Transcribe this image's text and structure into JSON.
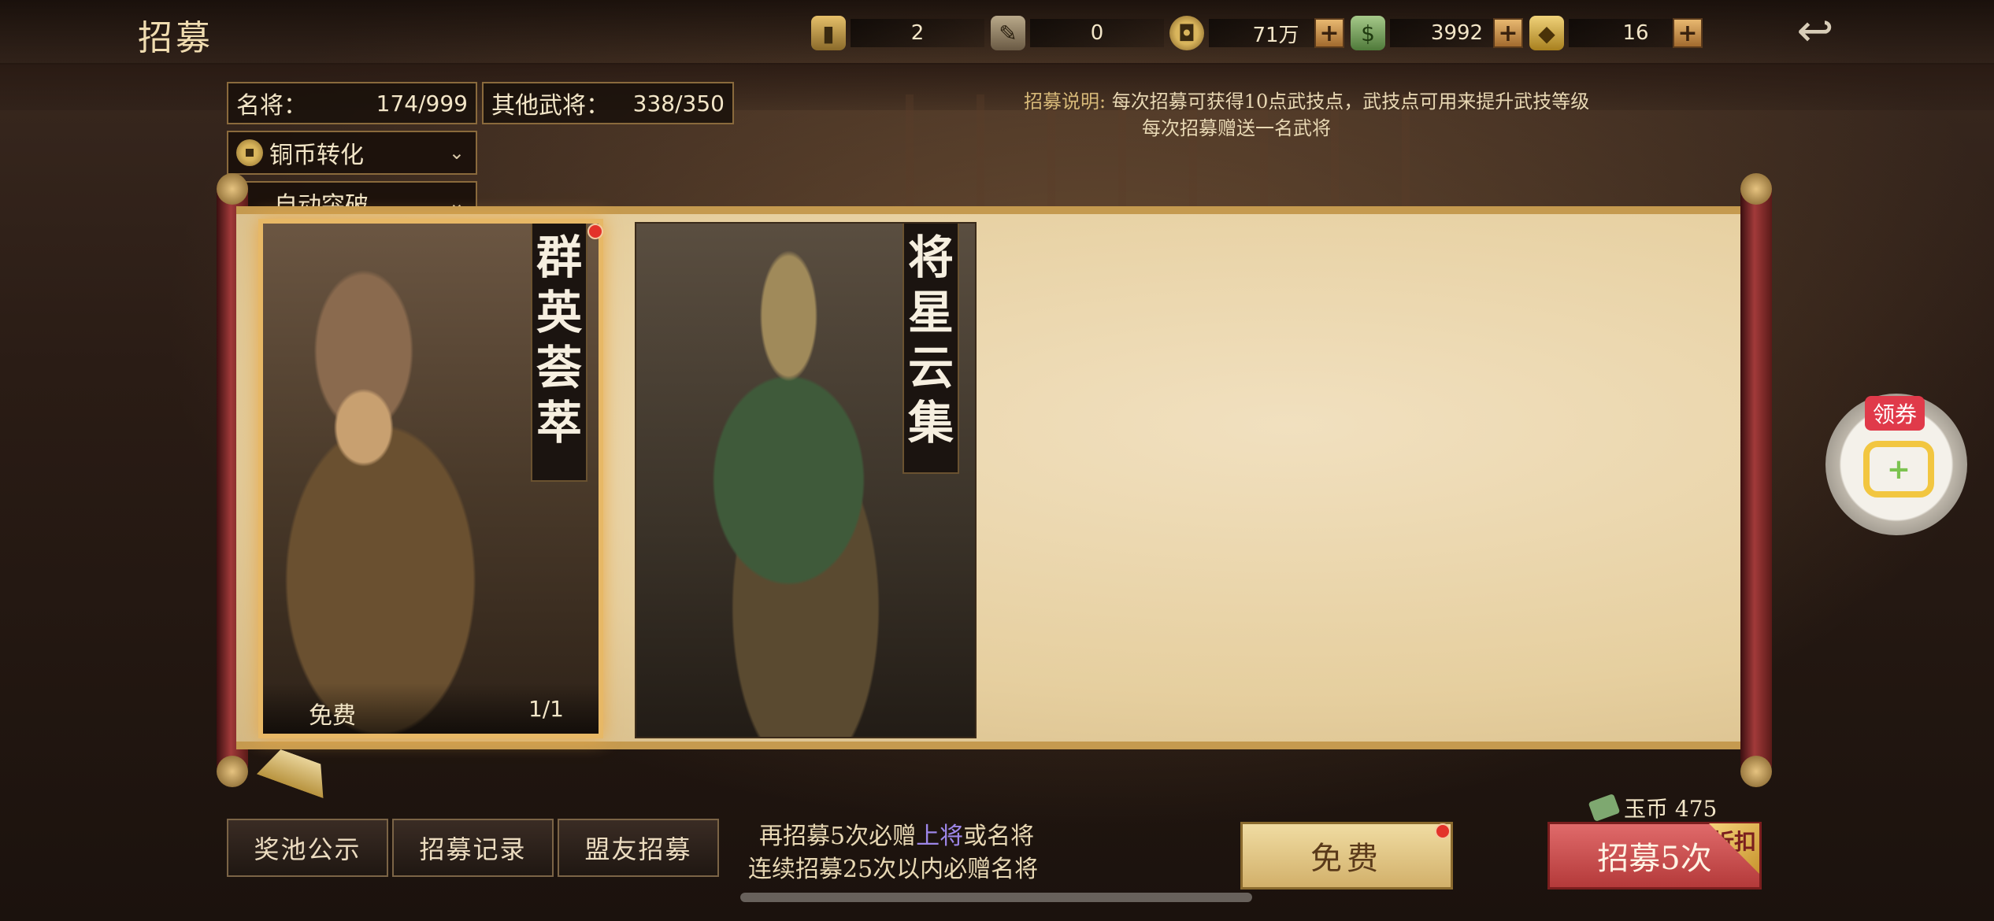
{
  "header": {
    "title": "招募",
    "resources": [
      {
        "icon": "recruit-token-icon",
        "value": "2"
      },
      {
        "icon": "scroll-order-icon",
        "value": "0"
      },
      {
        "icon": "copper-coin-icon",
        "value": "71万"
      },
      {
        "icon": "jade-coin-icon",
        "value": "3992"
      },
      {
        "icon": "gold-ingot-icon",
        "value": "16"
      }
    ],
    "plus_label": "+"
  },
  "stats": {
    "famous_label": "名将：",
    "famous_value": "174/999",
    "other_label": "其他武将：",
    "other_value": "338/350"
  },
  "dropdowns": {
    "coin_convert": "铜币转化",
    "auto_breakthrough": "自动突破"
  },
  "description": {
    "label": "招募说明:",
    "line1": "每次招募可获得10点武技点，武技点可用来提升武技等级",
    "line2": "每次招募赠送一名武将"
  },
  "cards": [
    {
      "banner": [
        "群",
        "英",
        "荟",
        "萃"
      ],
      "footer_left": "免费",
      "footer_right": "1/1"
    },
    {
      "banner": [
        "将",
        "星",
        "云",
        "集"
      ]
    }
  ],
  "coupon": {
    "label": "领券"
  },
  "bottom": {
    "pool_button": "奖池公示",
    "record_button": "招募记录",
    "ally_button": "盟友招募",
    "promo_line1_a": "再招募5次必赠",
    "promo_line1_hl": "上将",
    "promo_line1_b": "或名将",
    "promo_line2": "连续招募25次以内必赠名将",
    "free_button": "免费",
    "recruit_button": "招募5次",
    "discount_label": "折扣",
    "jade_label": "玉币 475"
  }
}
